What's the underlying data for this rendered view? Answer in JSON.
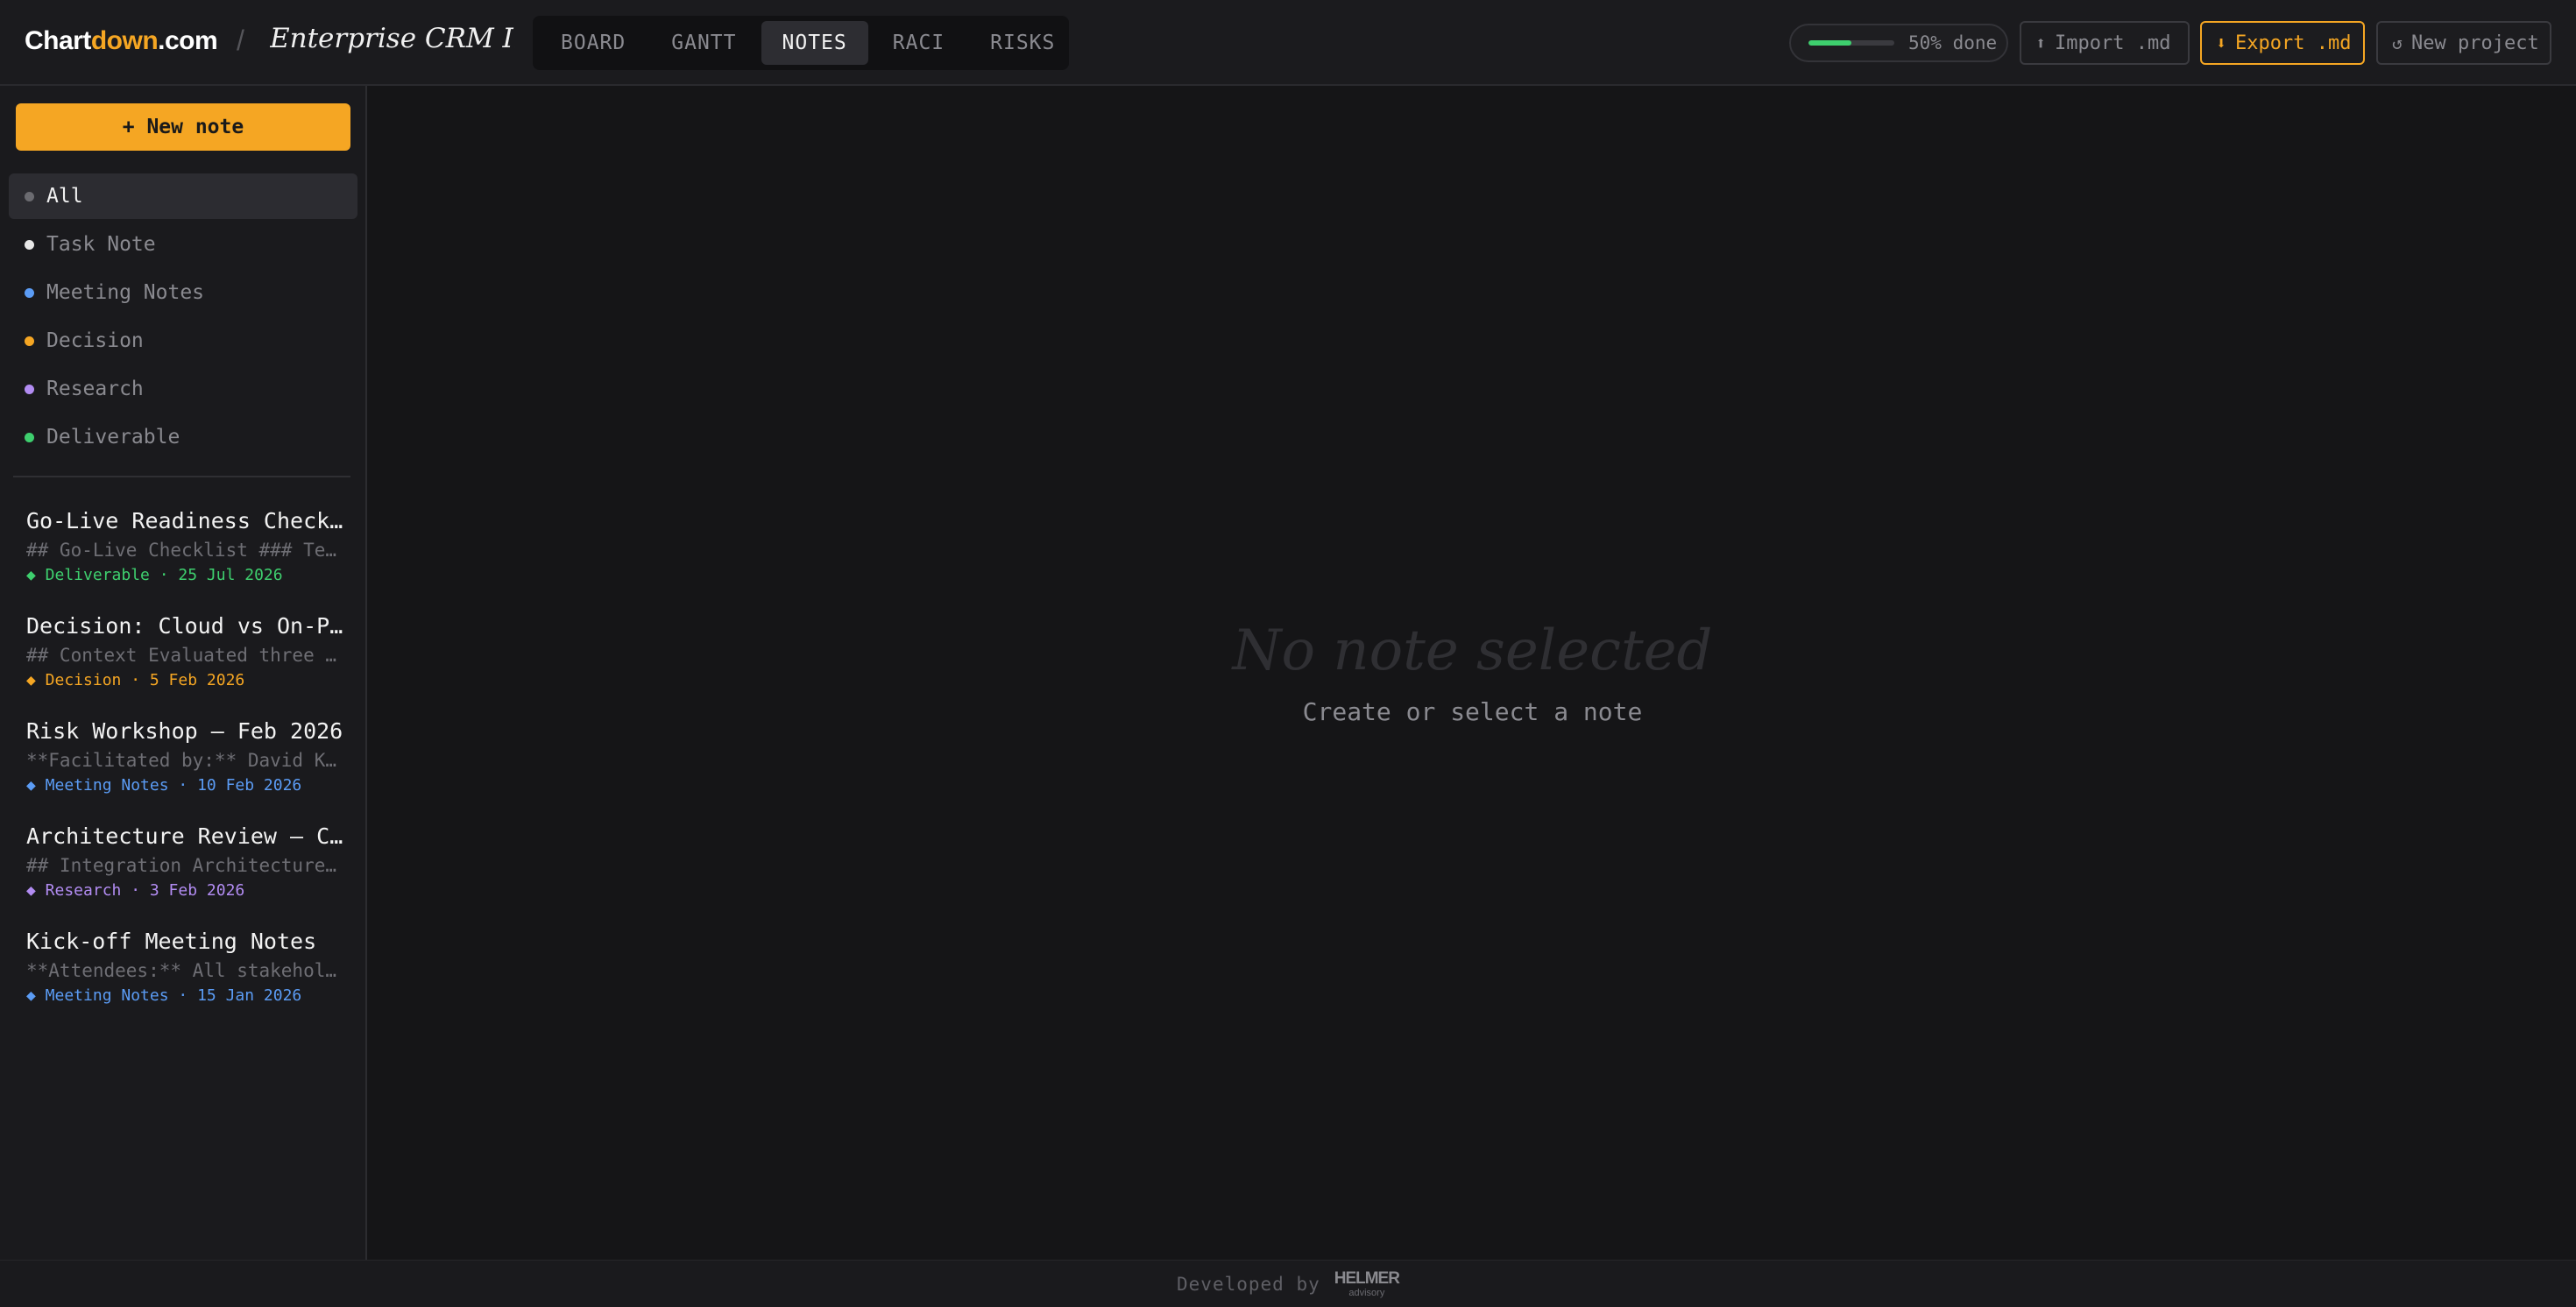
{
  "header": {
    "brand": {
      "part1": "Chart",
      "part2": "down",
      "part3": ".com"
    },
    "separator": "/",
    "project_title": "Enterprise CRM Implementation",
    "tabs": [
      {
        "label": "BOARD",
        "active": false
      },
      {
        "label": "GANTT",
        "active": false
      },
      {
        "label": "NOTES",
        "active": true
      },
      {
        "label": "RACI",
        "active": false
      },
      {
        "label": "RISKS",
        "active": false
      }
    ],
    "progress": {
      "value": 0.5,
      "label": "50% done",
      "color": "#3ecf6e"
    },
    "import": {
      "icon": "⬆",
      "label": "Import .md"
    },
    "export": {
      "icon": "⬇",
      "label": "Export .md"
    },
    "new_project": {
      "icon": "↺",
      "label": "New project"
    }
  },
  "sidebar": {
    "new_note_label": "+ New note",
    "filters": [
      {
        "label": "All",
        "color": "#6b6b70",
        "active": true
      },
      {
        "label": "Task Note",
        "color": "#e8e8e8",
        "active": false
      },
      {
        "label": "Meeting Notes",
        "color": "#5b9cf5",
        "active": false
      },
      {
        "label": "Decision",
        "color": "#f5a623",
        "active": false
      },
      {
        "label": "Research",
        "color": "#b28cf2",
        "active": false
      },
      {
        "label": "Deliverable",
        "color": "#3ecf6e",
        "active": false
      }
    ],
    "notes": [
      {
        "title": "Go-Live Readiness Checklist",
        "preview": "## Go-Live Checklist ### Technical",
        "meta": "◆ Deliverable · 25 Jul 2026",
        "color": "#3ecf6e"
      },
      {
        "title": "Decision: Cloud vs On-Premise",
        "preview": "## Context Evaluated three deployment",
        "meta": "◆ Decision · 5 Feb 2026",
        "color": "#f5a623"
      },
      {
        "title": "Risk Workshop — Feb 2026",
        "preview": "**Facilitated by:** David Kim",
        "meta": "◆ Meeting Notes · 10 Feb 2026",
        "color": "#5b9cf5"
      },
      {
        "title": "Architecture Review — CRM",
        "preview": "## Integration Architecture The",
        "meta": "◆ Research · 3 Feb 2026",
        "color": "#b28cf2"
      },
      {
        "title": "Kick-off Meeting Notes",
        "preview": "**Attendees:** All stakeholders",
        "meta": "◆ Meeting Notes · 15 Jan 2026",
        "color": "#5b9cf5"
      }
    ]
  },
  "main": {
    "empty_title": "No note selected",
    "empty_subtitle": "Create or select a note"
  },
  "footer": {
    "text": "Developed by",
    "logo_main": "HELMER",
    "logo_sub": "advisory"
  }
}
